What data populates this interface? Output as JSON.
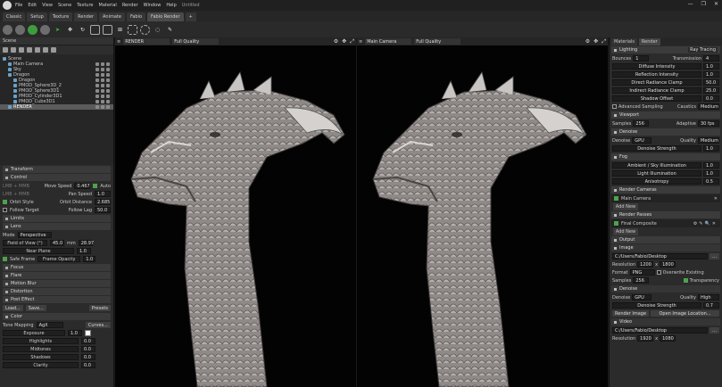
{
  "menubar": {
    "items": [
      "File",
      "Edit",
      "View",
      "Scene",
      "Texture",
      "Material",
      "Render",
      "Window",
      "Help"
    ],
    "title": "Untitled",
    "win": [
      "—",
      "❐",
      "✕"
    ]
  },
  "tabs": [
    "Classic",
    "Setup",
    "Texture",
    "Render",
    "Animate",
    "Fabio",
    "Fabio Render",
    "+"
  ],
  "scene": {
    "header": "Scene",
    "items": [
      "Scene",
      "Main Camera",
      "Sky",
      "Dragon",
      "Dragon",
      "PMOD_Sphere3D_2",
      "PMOD_Sphere3D1",
      "PMOD_Cylinder3D1",
      "PMOD_Cube3D1",
      "RENDER"
    ]
  },
  "left": {
    "transform": "Transform",
    "control": "Control",
    "move_speed_label": "Move Speed",
    "move_speed": "0.467",
    "auto_label": "Auto",
    "ms_label": "LMB + MMB",
    "pan_speed_label": "Pan Speed",
    "pan_speed": "1.0",
    "orbit_style": "Orbit Style",
    "orbit_distance_label": "Orbit Distance",
    "orbit_distance": "2.685",
    "follow_target": "Follow Target",
    "follow_lag_label": "Follow Lag",
    "follow_lag": "50.0",
    "limits": "Limits",
    "lens": "Lens",
    "mode_label": "Mode",
    "mode": "Perspective",
    "fov_label": "Field of View (°)",
    "fov": "45.0",
    "mm_label": "mm",
    "mm": "28.97",
    "near_label": "Near Plane",
    "near": "1.0",
    "safe_frame": "Safe Frame",
    "frame_opacity_label": "Frame Opacity",
    "frame_opacity": "1.0",
    "focus": "Focus",
    "flare": "Flare",
    "motion_blur": "Motion Blur",
    "distortion": "Distortion",
    "post_effect": "Post Effect",
    "load": "Load...",
    "save": "Save...",
    "presets": "Presets",
    "color": "Color",
    "tone_mapping_label": "Tone Mapping",
    "tone_mapping": "AgX",
    "curves": "Curves...",
    "exposure_label": "Exposure",
    "exposure": "1.0",
    "highlights_label": "Highlights",
    "highlights": "0.0",
    "midtones_label": "Midtones",
    "midtones": "0.0",
    "shadows_label": "Shadows",
    "shadows": "0.0",
    "clarity_label": "Clarity",
    "clarity": "0.0"
  },
  "viewports": [
    {
      "name": "RENDER",
      "quality": "Full Quality"
    },
    {
      "name": "Main Camera",
      "quality": "Full Quality"
    }
  ],
  "right": {
    "tabs": [
      "Materials",
      "Render"
    ],
    "lighting": "Lighting",
    "lighting_preset": "Ray Tracing",
    "bounces_label": "Bounces",
    "bounces": "1",
    "transmission_label": "Transmission",
    "transmission": "4",
    "diffuse_label": "Diffuse Intensity",
    "diffuse": "1.0",
    "reflection_label": "Reflection Intensity",
    "reflection": "1.0",
    "direct_clamp_label": "Direct Radiance Clamp",
    "direct_clamp": "50.0",
    "indirect_clamp_label": "Indirect Radiance Clamp",
    "indirect_clamp": "25.0",
    "shadow_offset_label": "Shadow Offset",
    "shadow_offset": "0.0",
    "adv_sampling": "Advanced Sampling",
    "caustics_label": "Caustics",
    "caustics": "Medium",
    "viewport": "Viewport",
    "samples_label": "Samples",
    "samples": "256",
    "adaptive_label": "Adaptive",
    "adaptive": "30 fps",
    "denoise": "Denoise",
    "denoise_label": "Denoise",
    "denoise_val": "GPU",
    "quality_label": "Quality",
    "quality": "Medium",
    "denoise_strength_label": "Denoise Strength",
    "denoise_strength": "1.0",
    "fog": "Fog",
    "ambient_label": "Ambient / Sky Illumination",
    "ambient": "1.0",
    "light_label": "Light Illumination",
    "light": "1.0",
    "aniso_label": "Anisotropy",
    "aniso": "0.5",
    "render_cameras": "Render Cameras",
    "main_camera": "Main Camera",
    "add_new": "Add New",
    "render_passes": "Render Passes",
    "final_composite": "Final Composite",
    "output": "Output",
    "image": "Image",
    "path": "C:/Users/Fabio/Desktop",
    "resolution_label": "Resolution",
    "res_w": "1200",
    "res_x": "x",
    "res_h": "1800",
    "format_label": "Format",
    "format": "PNG",
    "overwrite": "Overwrite Existing",
    "o_samples_label": "Samples",
    "o_samples": "256",
    "transparency": "Transparency",
    "o_denoise": "Denoise",
    "o_denoise_label": "Denoise",
    "o_denoise_val": "GPU",
    "o_quality_label": "Quality",
    "o_quality": "High",
    "o_strength_label": "Denoise Strength",
    "o_strength": "0.7",
    "render_image": "Render Image",
    "open_location": "Open Image Location...",
    "video": "Video",
    "v_path": "C:/Users/Fabio/Desktop",
    "v_res_label": "Resolution",
    "v_res_w": "1920",
    "v_res_x": "x",
    "v_res_h": "1080"
  }
}
